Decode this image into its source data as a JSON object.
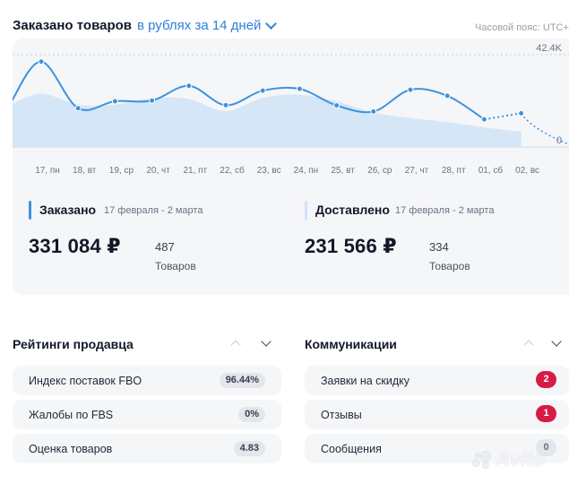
{
  "header": {
    "title": "Заказано товаров",
    "period": "в рублях за 14 дней",
    "timezone": "Часовой пояс: UTC+"
  },
  "colors": {
    "accent": "#2f7fd8",
    "line": "#3d93dd",
    "area": "#cfe3f7",
    "danger": "#d81b45"
  },
  "chart_data": {
    "type": "line",
    "categories": [
      "17, пн",
      "18, вт",
      "19, ср",
      "20, чт",
      "21, пт",
      "22, сб",
      "23, вс",
      "24, пн",
      "25, вт",
      "26, ср",
      "27, чт",
      "28, пт",
      "01, сб",
      "02, вс"
    ],
    "ylim": [
      0,
      42400
    ],
    "y_ticks": [
      "42.4K",
      "0"
    ],
    "series": [
      {
        "name": "Заказано",
        "values": [
          39200,
          17800,
          21000,
          21300,
          28100,
          19200,
          25900,
          26700,
          19100,
          16300,
          26300,
          23500,
          12700,
          15500
        ],
        "projected_end": 1200
      },
      {
        "name": "Доставлено",
        "values": [
          24500,
          19500,
          19500,
          22500,
          22000,
          16500,
          22500,
          24000,
          21000,
          15800,
          13300,
          11500,
          9000,
          7000
        ]
      }
    ]
  },
  "ordered": {
    "label": "Заказано",
    "dates": "17 февраля - 2 марта",
    "amount": "331 084 ₽",
    "count": "487",
    "count_label": "Товаров"
  },
  "delivered": {
    "label": "Доставлено",
    "dates": "17 февраля - 2 марта",
    "amount": "231 566 ₽",
    "count": "334",
    "count_label": "Товаров"
  },
  "ratings": {
    "title": "Рейтинги продавца",
    "items": [
      {
        "label": "Индекс поставок FBO",
        "value": "96.44%"
      },
      {
        "label": "Жалобы по FBS",
        "value": "0%"
      },
      {
        "label": "Оценка товаров",
        "value": "4.83"
      }
    ]
  },
  "communications": {
    "title": "Коммуникации",
    "items": [
      {
        "label": "Заявки на скидку",
        "count": "2"
      },
      {
        "label": "Отзывы",
        "count": "1"
      },
      {
        "label": "Сообщения",
        "count": "0"
      }
    ]
  },
  "watermark": "Avito"
}
